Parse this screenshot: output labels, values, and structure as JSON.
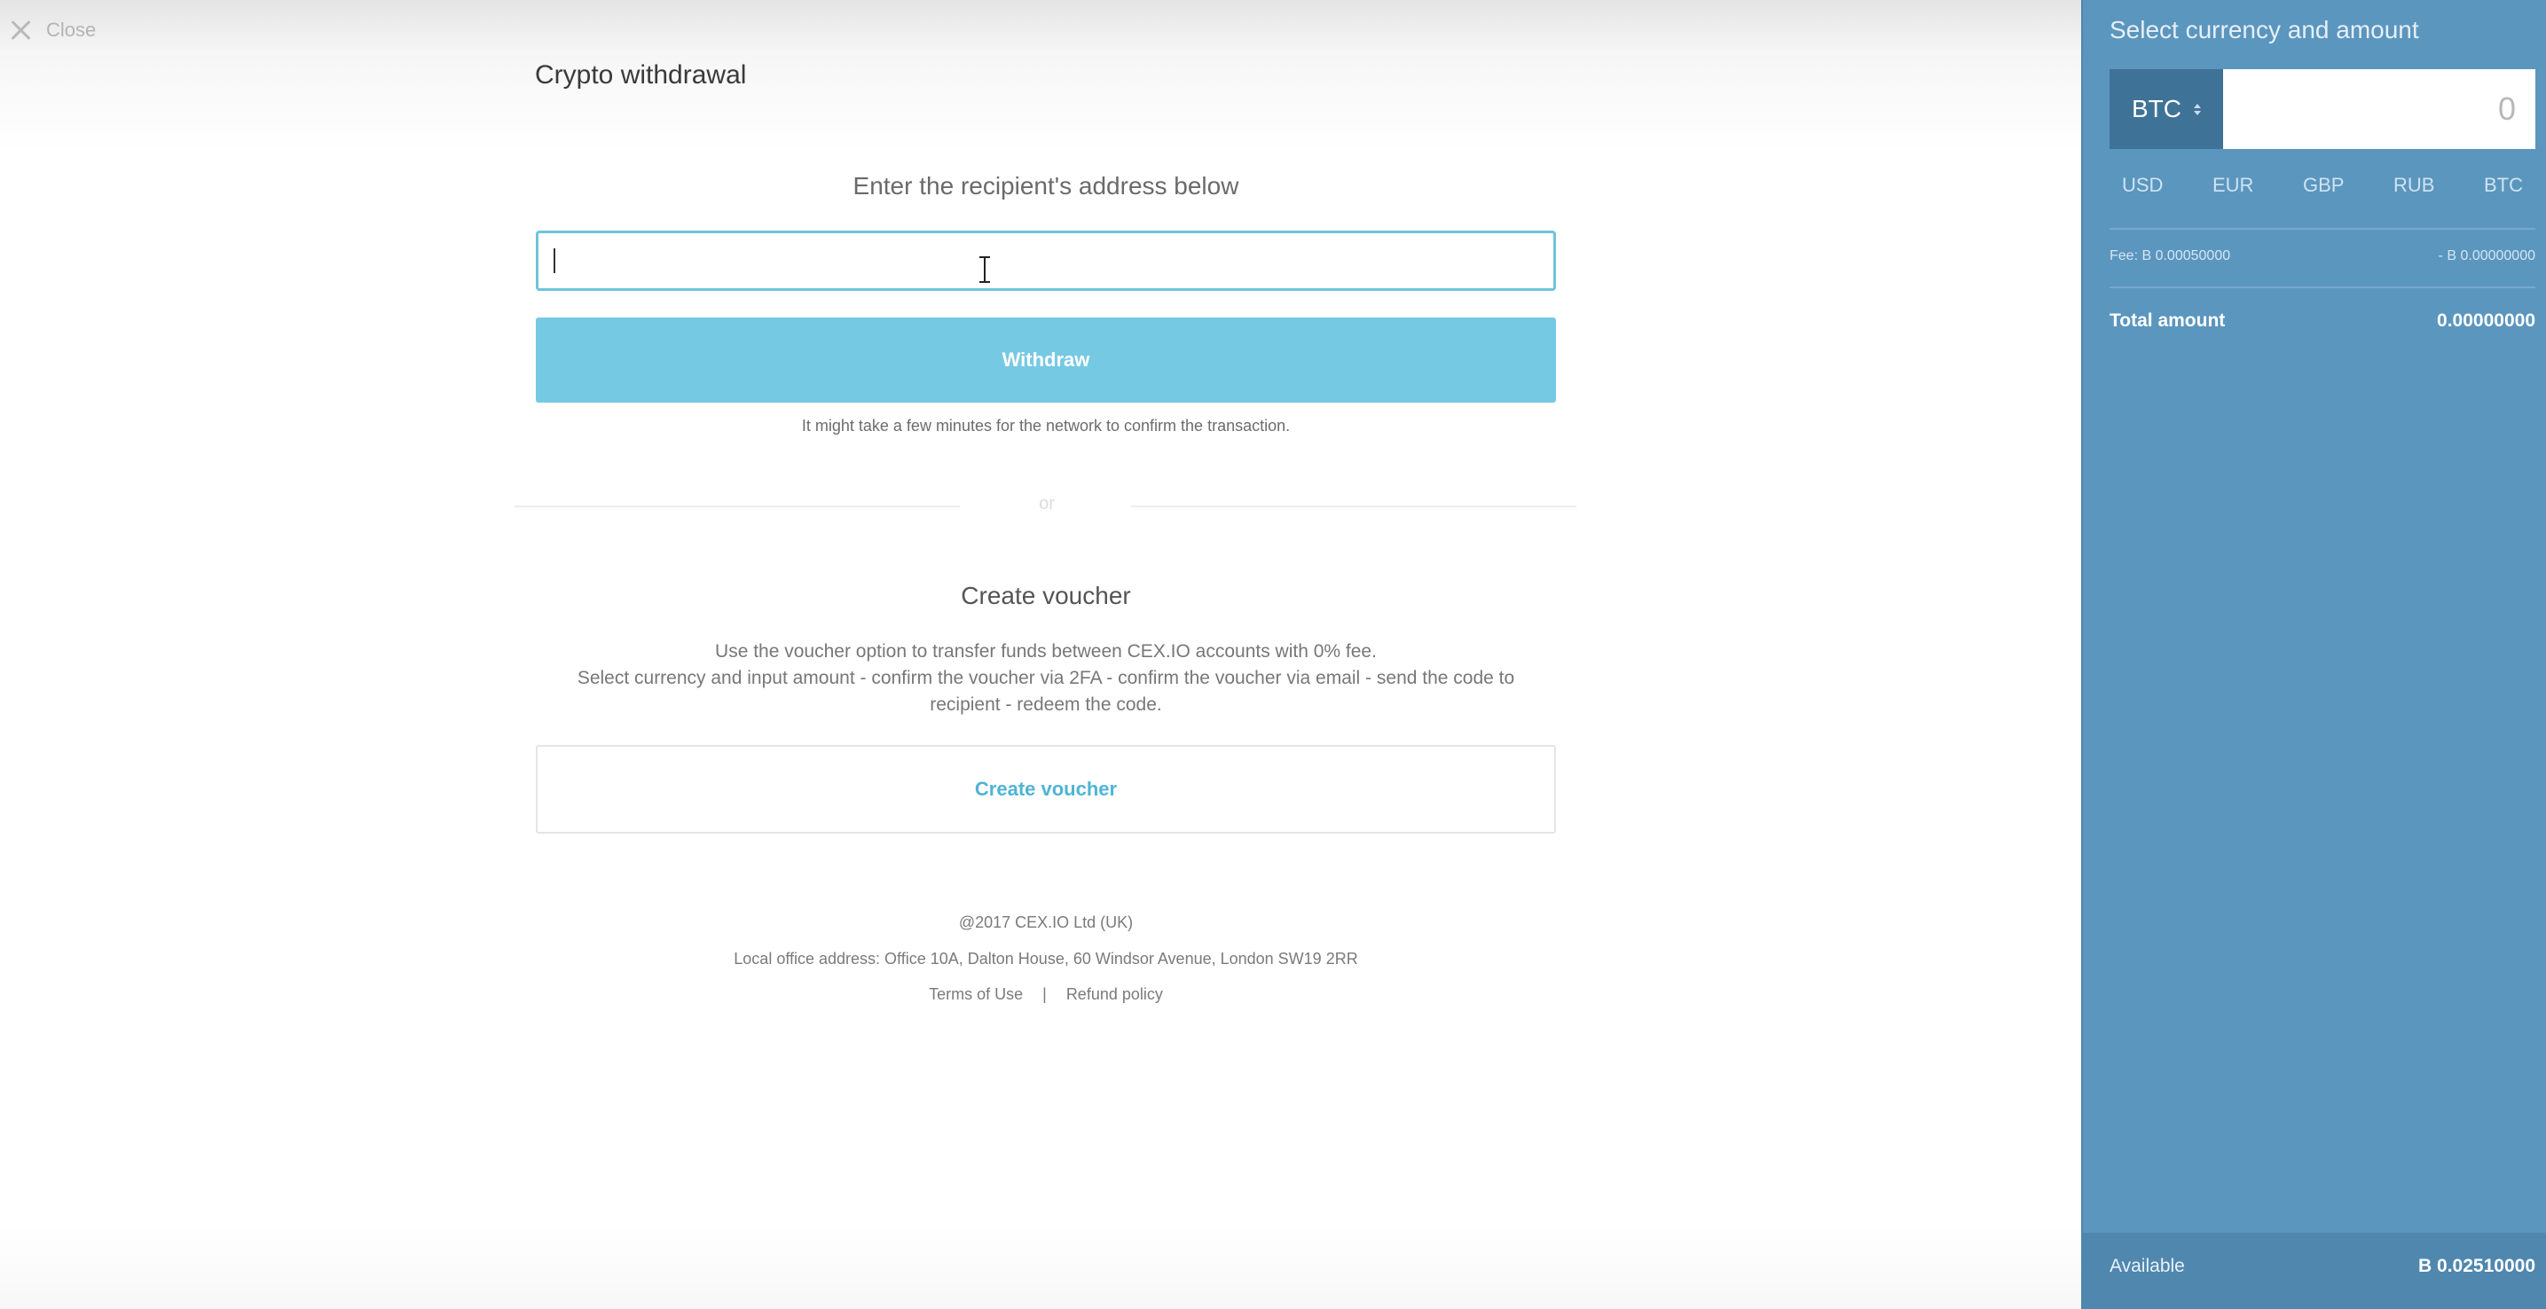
{
  "header": {
    "close_label": "Close",
    "page_title": "Crypto withdrawal"
  },
  "withdrawal": {
    "recipient_label": "Enter the recipient's address below",
    "address_value": "",
    "withdraw_label": "Withdraw",
    "network_note": "It might take a few minutes for the network to confirm the transaction."
  },
  "divider": {
    "or_label": "or"
  },
  "voucher": {
    "title": "Create voucher",
    "description_lines": [
      "Use the voucher option to transfer funds between CEX.IO accounts with 0% fee.",
      "Select currency and input amount - confirm the voucher via 2FA - confirm the voucher via email - send the code to",
      "recipient - redeem the code."
    ],
    "button_label": "Create voucher"
  },
  "footer": {
    "copyright": "@2017 CEX.IO Ltd (UK)",
    "address": "Local office address: Office 10A, Dalton House, 60 Windsor Avenue, London SW19 2RR",
    "terms_label": "Terms of Use",
    "separator": "|",
    "refund_label": "Refund policy"
  },
  "panel": {
    "title": "Select currency and amount",
    "selected_currency": "BTC",
    "amount_placeholder": "0",
    "currency_tabs": [
      "USD",
      "EUR",
      "GBP",
      "RUB",
      "BTC"
    ],
    "fee_label": "Fee: B 0.00050000",
    "fee_value": "- B 0.00000000",
    "total_label": "Total amount",
    "total_value": "0.00000000",
    "available_label": "Available",
    "available_value": "B 0.02510000"
  },
  "colors": {
    "accent": "#76c9e3",
    "panel_bg": "#5b96be",
    "panel_dark": "#3f7297",
    "link": "#4fb4d6"
  }
}
